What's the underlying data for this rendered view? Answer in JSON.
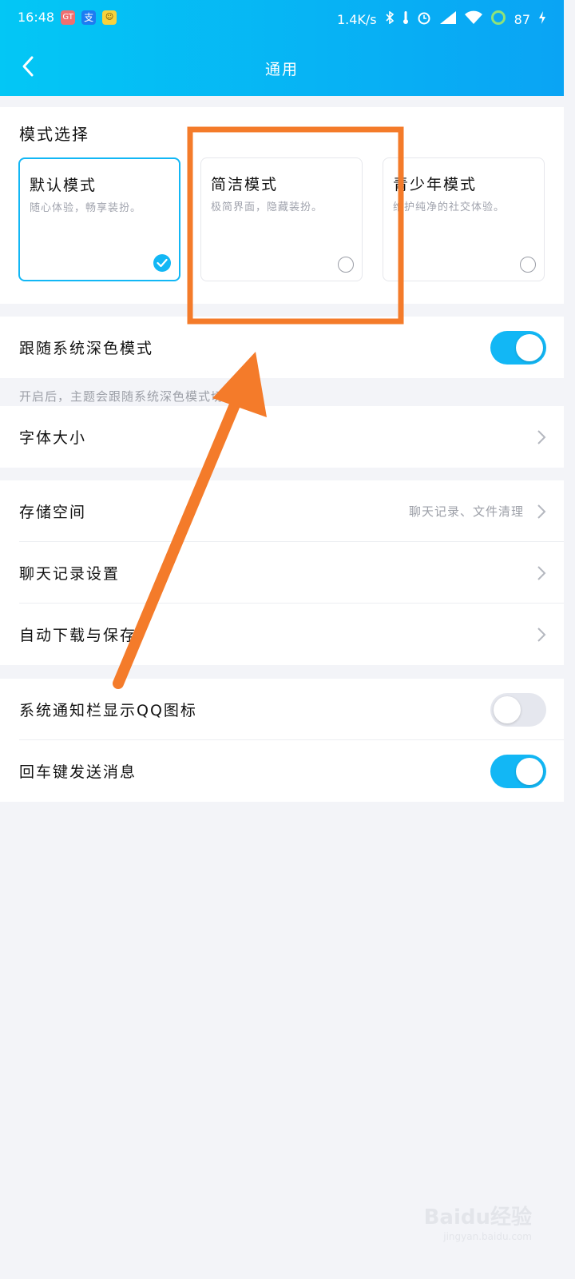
{
  "status": {
    "time": "16:48",
    "badges": [
      "GT",
      "支",
      "☺"
    ],
    "speed": "1.4K/s",
    "battery": "87"
  },
  "nav": {
    "title": "通用"
  },
  "mode_section": {
    "title": "模式选择",
    "modes": [
      {
        "name": "默认模式",
        "desc": "随心体验，畅享装扮。",
        "selected": true
      },
      {
        "name": "简洁模式",
        "desc": "极简界面，隐藏装扮。",
        "selected": false
      },
      {
        "name": "青少年模式",
        "desc": "维护纯净的社交体验。",
        "selected": false
      }
    ]
  },
  "settings": {
    "dark_mode": {
      "label": "跟随系统深色模式",
      "on": true,
      "hint": "开启后，主题会跟随系统深色模式切换"
    },
    "font_size": {
      "label": "字体大小"
    },
    "storage": {
      "label": "存储空间",
      "value": "聊天记录、文件清理"
    },
    "chat_history": {
      "label": "聊天记录设置"
    },
    "auto_download": {
      "label": "自动下载与保存"
    },
    "notif_icon": {
      "label": "系统通知栏显示QQ图标",
      "on": false
    },
    "enter_send": {
      "label": "回车键发送消息",
      "on": true
    }
  },
  "annotation": {
    "color": "#f47b2a"
  },
  "watermark": {
    "text": "Baidu经验",
    "url": "jingyan.baidu.com"
  }
}
